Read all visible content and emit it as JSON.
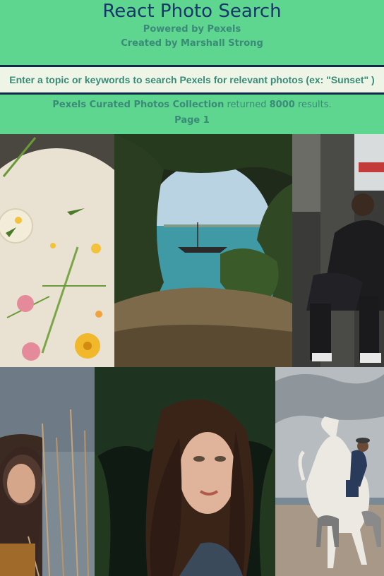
{
  "header": {
    "title": "React Photo Search",
    "powered_by": "Powered by Pexels",
    "created_by": "Created by Marshall Strong"
  },
  "search": {
    "placeholder": "Enter a topic or keywords to search Pexels for relevant photos (ex: \"Sunset\" )",
    "value": ""
  },
  "results": {
    "collection": "Pexels Curated Photos Collection",
    "returned_word": "returned",
    "count": "8000",
    "results_word": "results.",
    "page_label": "Page 1"
  },
  "colors": {
    "background": "#5ed68f",
    "title": "#17376b",
    "text": "#3a8a78",
    "search_bg": "#eef5e6",
    "search_border": "#102a4a"
  },
  "photos": [
    {
      "subject": "flowers-on-table"
    },
    {
      "subject": "sailboat-through-trees"
    },
    {
      "subject": "man-on-subway"
    },
    {
      "subject": "woman-in-reeds"
    },
    {
      "subject": "woman-in-foliage"
    },
    {
      "subject": "horse-rider-on-beach"
    }
  ]
}
